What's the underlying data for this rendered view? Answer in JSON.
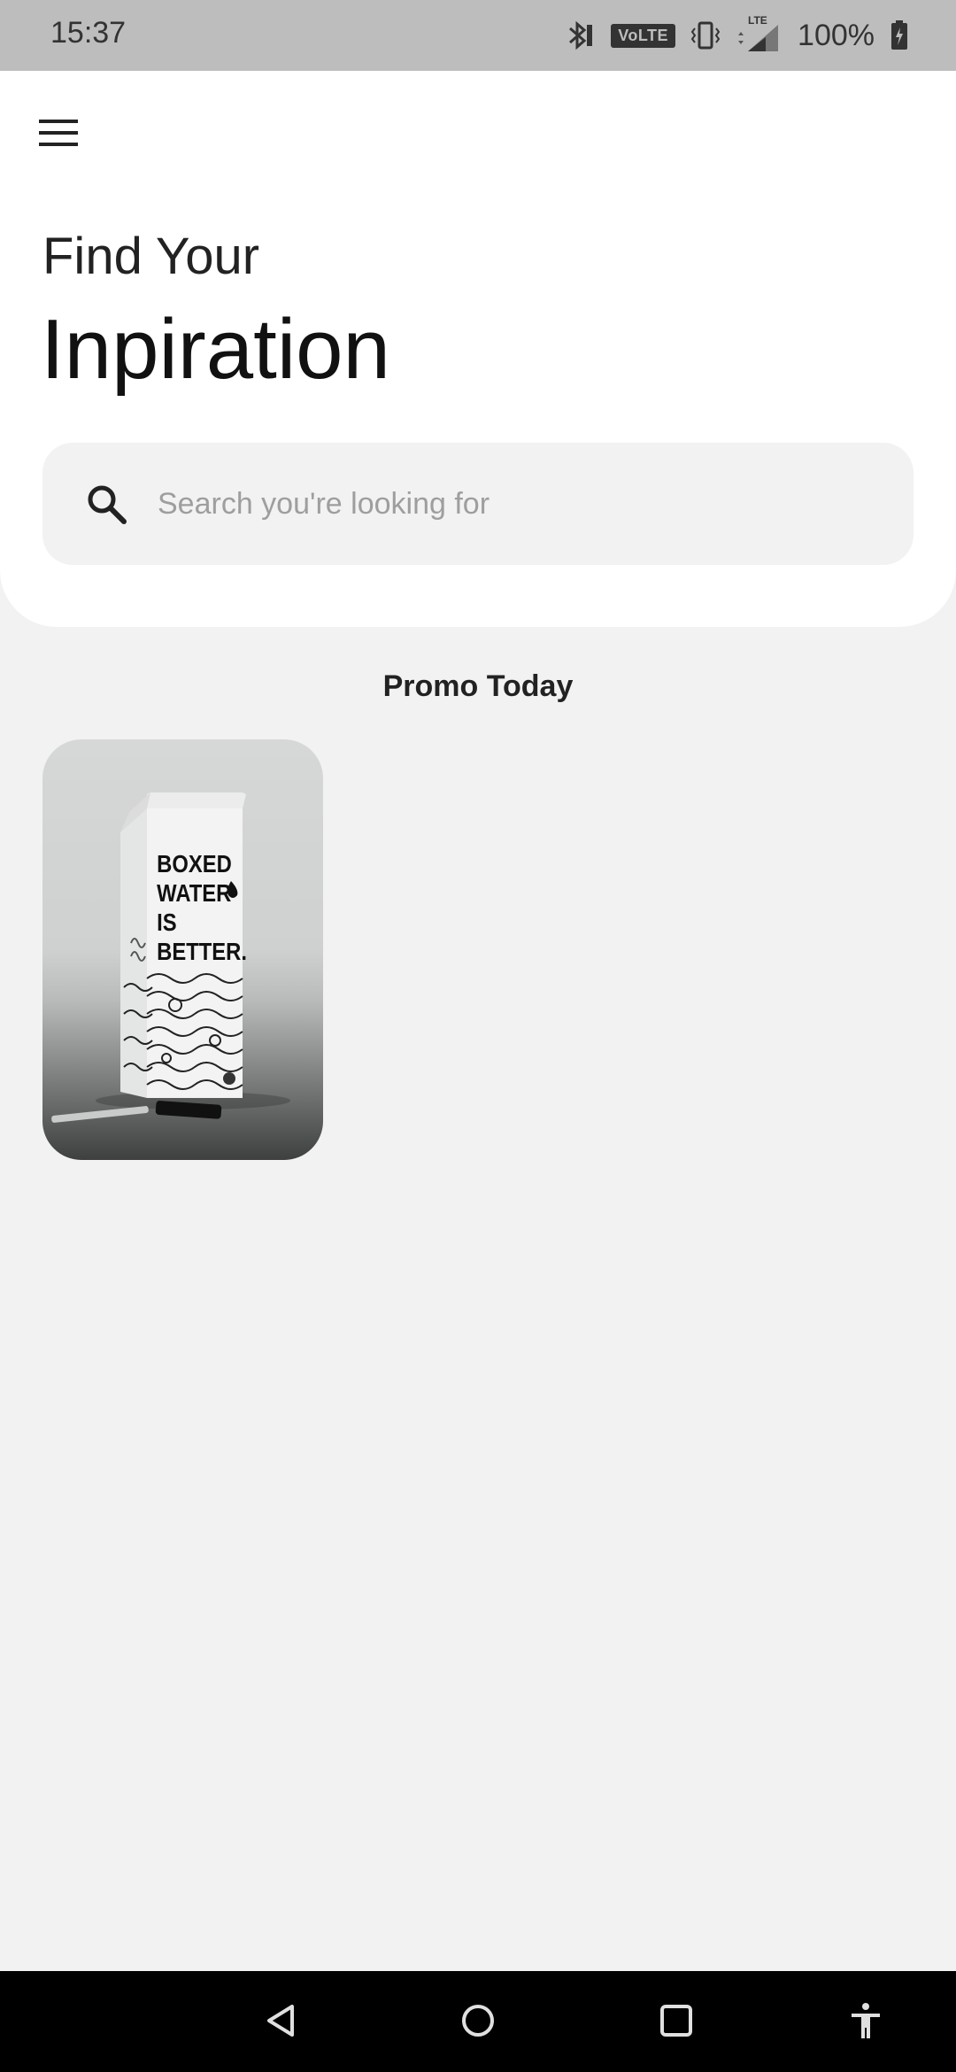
{
  "status_bar": {
    "time": "15:37",
    "volte_label": "VoLTE",
    "lte_label": "LTE",
    "battery_percent": "100%",
    "icons": [
      "bluetooth-icon",
      "volte-icon",
      "vibrate-icon",
      "signal-icon",
      "battery-charging-icon"
    ]
  },
  "header": {
    "menu_icon": "hamburger-menu-icon",
    "heading_small": "Find Your",
    "heading_large": "Inpiration"
  },
  "search": {
    "placeholder": "Search you're looking for",
    "value": "",
    "icon": "search-icon"
  },
  "promo": {
    "section_title": "Promo Today",
    "items": [
      {
        "image_text": [
          "BOXED",
          "WATER",
          "IS",
          "BETTER."
        ]
      }
    ]
  },
  "nav_bar": {
    "icons": [
      "back-icon",
      "home-icon",
      "recents-icon",
      "accessibility-icon"
    ]
  },
  "colors": {
    "background": "#f2f2f2",
    "card": "#ffffff",
    "status_bar": "#bdbdbd",
    "nav_bar": "#000000"
  }
}
